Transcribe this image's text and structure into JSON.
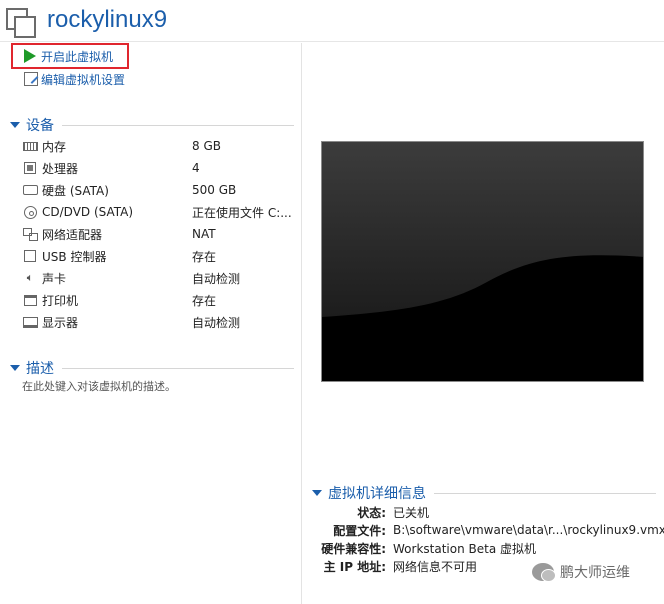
{
  "header": {
    "title": "rockylinux9"
  },
  "actions": {
    "power_on": "开启此虚拟机",
    "edit_settings": "编辑虚拟机设置"
  },
  "devices": {
    "section_title": "设备",
    "items": [
      {
        "name": "内存",
        "value": "8 GB",
        "icon": "memory-icon"
      },
      {
        "name": "处理器",
        "value": "4",
        "icon": "cpu-icon"
      },
      {
        "name": "硬盘 (SATA)",
        "value": "500 GB",
        "icon": "hard-disk-icon"
      },
      {
        "name": "CD/DVD (SATA)",
        "value": "正在使用文件 C:...",
        "icon": "cd-dvd-icon"
      },
      {
        "name": "网络适配器",
        "value": "NAT",
        "icon": "network-adapter-icon"
      },
      {
        "name": "USB 控制器",
        "value": "存在",
        "icon": "usb-icon"
      },
      {
        "name": "声卡",
        "value": "自动检测",
        "icon": "sound-card-icon"
      },
      {
        "name": "打印机",
        "value": "存在",
        "icon": "printer-icon"
      },
      {
        "name": "显示器",
        "value": "自动检测",
        "icon": "monitor-icon"
      }
    ]
  },
  "description": {
    "section_title": "描述",
    "placeholder": "在此处键入对该虚拟机的描述。"
  },
  "details": {
    "section_title": "虚拟机详细信息",
    "rows": [
      {
        "label": "状态:",
        "value": "已关机"
      },
      {
        "label": "配置文件:",
        "value": "B:\\software\\vmware\\data\\r...\\rockylinux9.vmx"
      },
      {
        "label": "硬件兼容性:",
        "value": "Workstation Beta 虚拟机"
      },
      {
        "label": "主 IP 地址:",
        "value": "网络信息不可用"
      }
    ]
  },
  "watermark": {
    "text": "鹏大师运维"
  },
  "colors": {
    "accent": "#1b5eab",
    "play": "#1e9a28",
    "highlight_border": "#e0262e"
  }
}
